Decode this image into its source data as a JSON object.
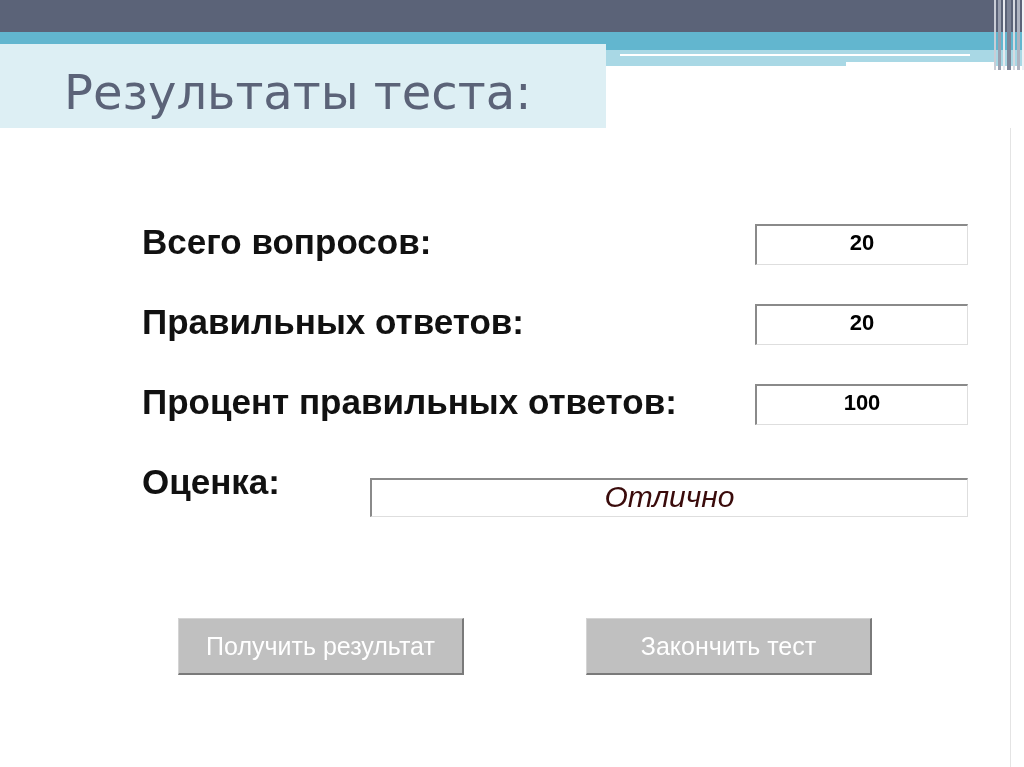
{
  "title": "Результаты теста:",
  "results": [
    {
      "kind": "number",
      "label": "Всего вопросов:",
      "value": "20"
    },
    {
      "kind": "number",
      "label": "Правильных ответов:",
      "value": "20"
    },
    {
      "kind": "number",
      "label": "Процент правильных ответов:",
      "value": "100"
    },
    {
      "kind": "grade",
      "label": "Оценка:",
      "value": "Отлично"
    }
  ],
  "buttons": [
    {
      "label": "Получить результат"
    },
    {
      "label": "Закончить тест"
    }
  ]
}
